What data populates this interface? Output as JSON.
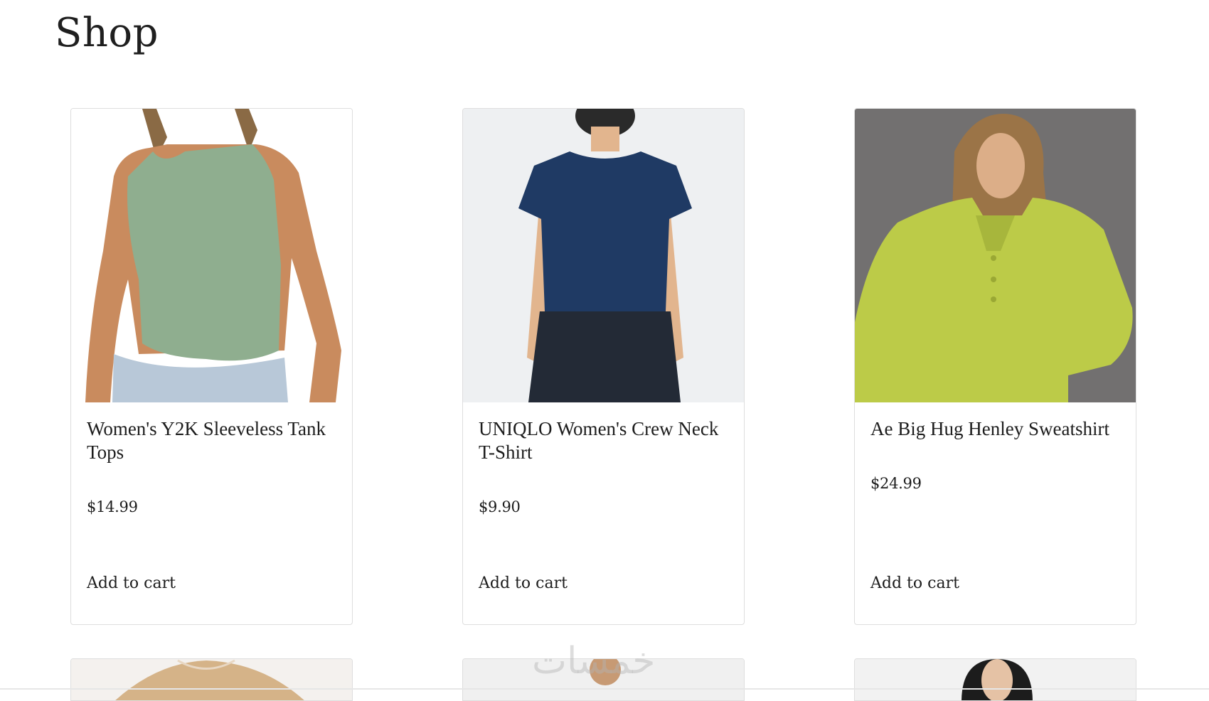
{
  "page": {
    "title": "Shop"
  },
  "products": [
    {
      "name": "Women's Y2K Sleeveless Tank Tops",
      "price": "$14.99",
      "add_label": "Add to cart",
      "image_icon": "green-tank-top-image"
    },
    {
      "name": "UNIQLO Women's Crew Neck T-Shirt",
      "price": "$9.90",
      "add_label": "Add to cart",
      "image_icon": "navy-tshirt-image"
    },
    {
      "name": "Ae Big Hug Henley Sweatshirt",
      "price": "$24.99",
      "add_label": "Add to cart",
      "image_icon": "lime-sweatshirt-image"
    }
  ],
  "next_row_images": [
    "tan-sweater-image",
    "model-image",
    "model-dark-hair-image"
  ],
  "watermark": "خمسات",
  "colors": {
    "card_border": "#dedede",
    "text": "#1d1d1d",
    "tank_green": "#8fae8f",
    "tee_navy": "#1f3a64",
    "sweat_lime": "#bccb48"
  }
}
